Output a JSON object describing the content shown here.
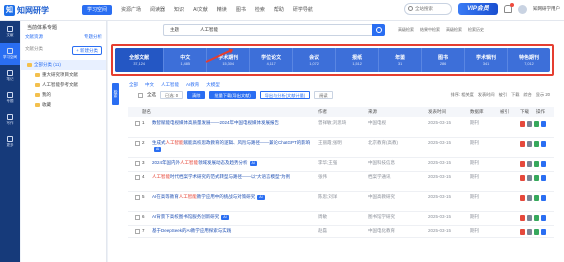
{
  "brand": {
    "logo_mark": "知",
    "name": "知网研学"
  },
  "nav": [
    "学习空间",
    "资源广场",
    "阅读器",
    "知识",
    "AI文献",
    "精读",
    "图书",
    "检索",
    "帮助",
    "研学导航"
  ],
  "top_right": {
    "search": "全站搜索",
    "vip": "VIP会员",
    "user": "知网研学用户"
  },
  "sidebar": {
    "items": [
      {
        "label": "文献"
      },
      {
        "label": "学习空间"
      },
      {
        "label": "笔记"
      },
      {
        "label": "专题"
      },
      {
        "label": "写作"
      },
      {
        "label": "更多"
      }
    ]
  },
  "panel": {
    "title": "当前体系专题",
    "sub_left": "文献资源",
    "sub_right": "专题分析",
    "filter_label": "文献分类",
    "new_btn": "+ 新建分类",
    "tree": [
      {
        "label": "全部分类 (11)",
        "selected": true,
        "child": false
      },
      {
        "label": "重大研究项目文献",
        "selected": false,
        "child": true
      },
      {
        "label": "人工智能参考文献",
        "selected": false,
        "child": true
      },
      {
        "label": "我的",
        "selected": false,
        "child": true
      },
      {
        "label": "收藏",
        "selected": false,
        "child": true
      }
    ]
  },
  "search": {
    "scope": "主题",
    "query": "人工智能",
    "extra": [
      "高级检索",
      "结果中检索",
      "高级检索",
      "检索历史"
    ]
  },
  "categories": [
    {
      "label": "全部文献",
      "count": "37,124",
      "active": true
    },
    {
      "label": "中文",
      "count": "1,485"
    },
    {
      "label": "学术期刊",
      "count": "15,304"
    },
    {
      "label": "学位论文",
      "count": "4,117"
    },
    {
      "label": "会议",
      "count": "1,072"
    },
    {
      "label": "报纸",
      "count": "1,512"
    },
    {
      "label": "年鉴",
      "count": "31"
    },
    {
      "label": "图书",
      "count": "286"
    },
    {
      "label": "学术辑刊",
      "count": "341"
    },
    {
      "label": "特色期刊",
      "count": "7,012"
    }
  ],
  "left_tab": "检索",
  "filters": [
    "全部",
    "中文",
    "人工智能",
    "AI教育",
    "大模型"
  ],
  "toolbar": {
    "select_all": "全选",
    "buttons": [
      {
        "label": "已选: 0",
        "style": "plain"
      },
      {
        "label": "清除",
        "style": "blue"
      },
      {
        "label": "批量下载(导出文献)",
        "style": "blue"
      },
      {
        "label": "导出与分析(文献计量)",
        "style": "ob"
      },
      {
        "label": "阅读",
        "style": "plain"
      }
    ],
    "sort": [
      "排序: 相关度",
      "发表时间",
      "被引",
      "下载",
      "综合",
      "显示 20"
    ]
  },
  "table": {
    "headers": [
      "题名",
      "作者",
      "来源",
      "发表时间",
      "数据库",
      "被引",
      "下载",
      "操作"
    ],
    "rows": [
      {
        "n": "1",
        "pre": "数智赋能电视媒体高质量发展——2024年中国电视媒体",
        "hl": "",
        "post": "发展报告",
        "tag": "",
        "author": "曾祥敏;刘思琦",
        "source": "中国电视",
        "date": "2025-03-15",
        "db": "期刊",
        "cite": "",
        "dl": ""
      },
      {
        "n": "2",
        "pre": "生成式",
        "hl": "人工智能",
        "post": "赋能高校思政教育的逻辑、风险与路径——兼论ChatGPT的影响",
        "tag": "AI",
        "author": "王丽霞;张明",
        "source": "北京教育(高教)",
        "date": "2025-03-15",
        "db": "期刊",
        "cite": "",
        "dl": ""
      },
      {
        "n": "3",
        "pre": "2024年国内外",
        "hl": "人工智能",
        "post": "领域发展动态及趋势分析",
        "tag": "AI",
        "author": "李华;王强",
        "source": "中国科技信息",
        "date": "2025-03-15",
        "db": "期刊",
        "cite": "",
        "dl": ""
      },
      {
        "n": "4",
        "pre": "",
        "hl": "人工智能",
        "post": "时代档案学术研究的范式转型与路径——以“大语言模型”为例",
        "tag": "",
        "author": "张伟",
        "source": "档案学通讯",
        "date": "2025-03-15",
        "db": "期刊",
        "cite": "",
        "dl": ""
      },
      {
        "n": "5",
        "pre": "AI在高等教育",
        "hl": "人工智能",
        "post": "教学应用中的挑战与对策研究",
        "tag": "AI",
        "author": "陈思;刘洋",
        "source": "中国高教研究",
        "date": "2025-03-15",
        "db": "期刊",
        "cite": "",
        "dl": ""
      },
      {
        "n": "6",
        "pre": "AI背景下高校图书馆服务创新研究",
        "hl": "",
        "post": "",
        "tag": "AI",
        "author": "周敏",
        "source": "图书馆学研究",
        "date": "2025-03-15",
        "db": "期刊",
        "cite": "",
        "dl": ""
      },
      {
        "n": "7",
        "pre": "基于DeepSeek的AI教学应用探索与实践",
        "hl": "",
        "post": "",
        "tag": "",
        "author": "赵磊",
        "source": "中国电化教育",
        "date": "2025-03-15",
        "db": "期刊",
        "cite": "",
        "dl": ""
      }
    ]
  }
}
